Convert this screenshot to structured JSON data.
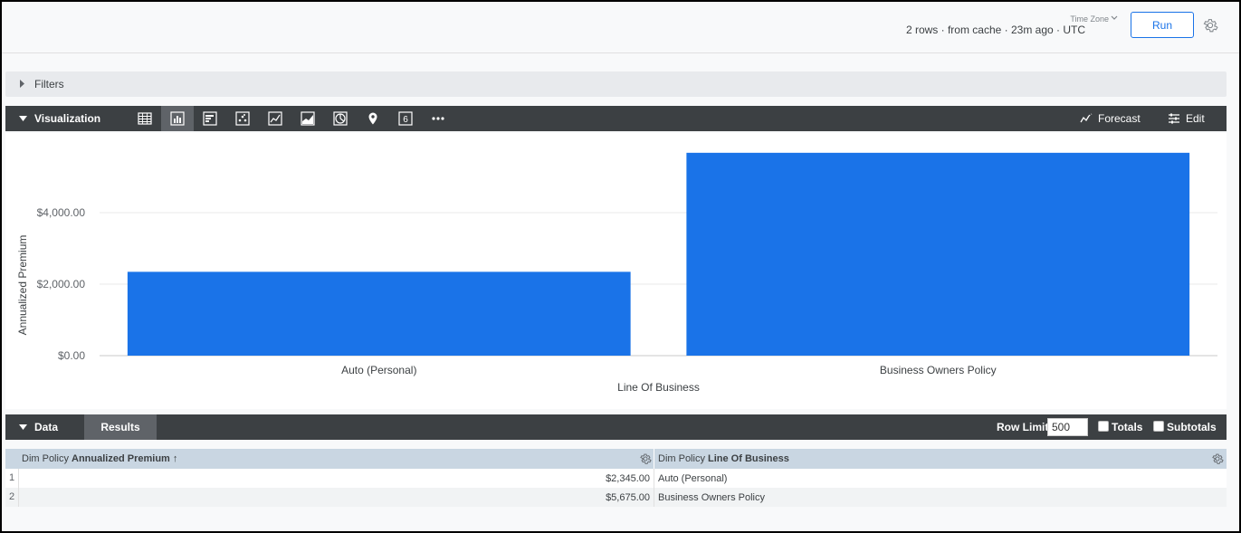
{
  "header": {
    "status": "2 rows · from cache · 23m ago · UTC",
    "timezone_label": "Time Zone",
    "run_label": "Run"
  },
  "filters": {
    "label": "Filters"
  },
  "visualization": {
    "title": "Visualization",
    "icons": [
      "table-icon",
      "bar-chart-icon",
      "column-chart-icon",
      "scatter-icon",
      "line-chart-icon",
      "area-chart-icon",
      "pie-chart-icon",
      "map-pin-icon",
      "single-value-icon",
      "more-icon"
    ],
    "active_icon": "bar-chart-icon",
    "single_value_glyph": "6",
    "forecast_label": "Forecast",
    "edit_label": "Edit"
  },
  "chart_data": {
    "type": "bar",
    "categories": [
      "Auto (Personal)",
      "Business Owners Policy"
    ],
    "values": [
      2345,
      5675
    ],
    "xlabel": "Line Of Business",
    "ylabel": "Annualized Premium",
    "ylim": [
      0,
      6000
    ],
    "yticks": [
      0,
      2000,
      4000
    ],
    "ytick_labels": [
      "$0.00",
      "$2,000.00",
      "$4,000.00"
    ],
    "bar_color": "#1a73e8",
    "grid": true
  },
  "data_section": {
    "title": "Data",
    "results_tab": "Results",
    "row_limit_label": "Row Limit",
    "row_limit_value": "500",
    "totals_label": "Totals",
    "subtotals_label": "Subtotals"
  },
  "table": {
    "col1_prefix": "Dim Policy ",
    "col1_name": "Annualized Premium",
    "col1_sort": "↑",
    "col2_prefix": "Dim Policy ",
    "col2_name": "Line Of Business",
    "rows": [
      {
        "num": "1",
        "premium": "$2,345.00",
        "lob": "Auto (Personal)"
      },
      {
        "num": "2",
        "premium": "$5,675.00",
        "lob": "Business Owners Policy"
      }
    ]
  }
}
